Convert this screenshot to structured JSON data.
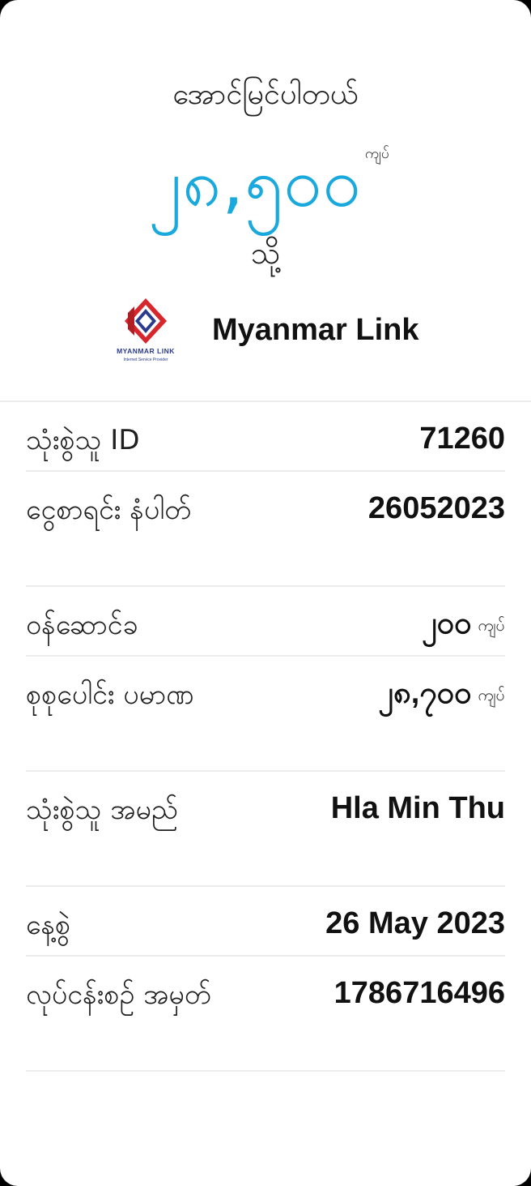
{
  "header": {
    "status": "အောင်မြင်ပါတယ်",
    "amount": "၂၈,၅၀၀",
    "currency": "ကျပ်",
    "to_label": "သို့"
  },
  "merchant": {
    "name": "Myanmar Link",
    "logo_text": "MYANMAR LINK",
    "logo_subtext": "Internet Service Provider",
    "logo_colors": [
      "#d8262d",
      "#2a3b8f"
    ]
  },
  "details": [
    {
      "label": "သုံးစွဲသူ ID",
      "value": "71260",
      "unit": ""
    },
    {
      "label": "ငွေစာရင်း နံပါတ်",
      "value": "26052023",
      "unit": ""
    },
    {
      "label": "ဝန်ဆောင်ခ",
      "value": "၂၀၀",
      "unit": "ကျပ်"
    },
    {
      "label": "စုစုပေါင်း ပမာဏ",
      "value": "၂၈,၇၀၀",
      "unit": "ကျပ်"
    },
    {
      "label": "သုံးစွဲသူ အမည်",
      "value": "Hla Min Thu",
      "unit": ""
    },
    {
      "label": "နေ့စွဲ",
      "value": "26 May 2023",
      "unit": ""
    },
    {
      "label": "လုပ်ငန်းစဉ် အမှတ်",
      "value": "1786716496",
      "unit": ""
    }
  ],
  "colors": {
    "accent": "#1aa9dc",
    "background": "#ffffff",
    "divider": "#ececec",
    "text": "#111111"
  }
}
